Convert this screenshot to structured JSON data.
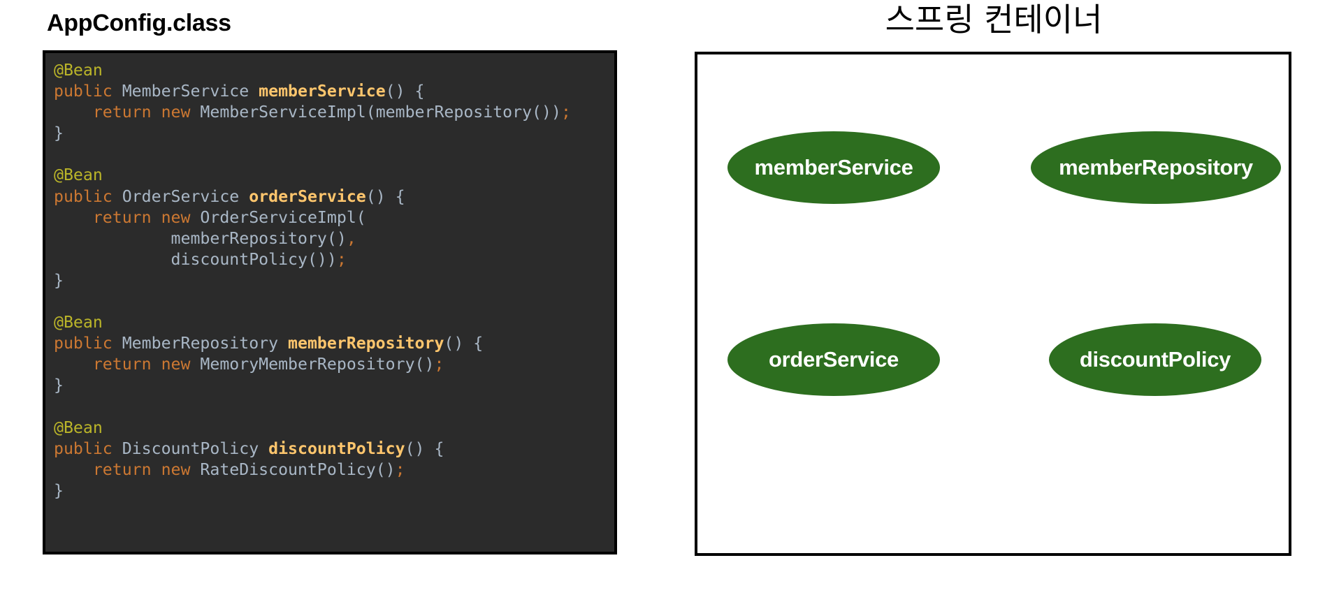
{
  "code_panel": {
    "title": "AppConfig.class",
    "colors": {
      "background": "#2b2b2b",
      "annotation": "#bbb529",
      "keyword": "#cc7832",
      "method_name": "#ffc66d",
      "plain": "#a9b7c6"
    },
    "beans": [
      {
        "annotation": "@Bean",
        "modifier": "public",
        "return_type": " MemberService ",
        "method": "memberService",
        "signature_tail": "() {",
        "body": [
          {
            "indent": "    ",
            "kw": "return new",
            "text": " MemberServiceImpl(memberRepository())",
            "semi": ";"
          }
        ],
        "close": "}"
      },
      {
        "annotation": "@Bean",
        "modifier": "public",
        "return_type": " OrderService ",
        "method": "orderService",
        "signature_tail": "() {",
        "body": [
          {
            "indent": "    ",
            "kw": "return new",
            "text": " OrderServiceImpl(",
            "semi": ""
          },
          {
            "indent": "            ",
            "kw": "",
            "text": "memberRepository()",
            "semi": ","
          },
          {
            "indent": "            ",
            "kw": "",
            "text": "discountPolicy())",
            "semi": ";"
          }
        ],
        "close": "}"
      },
      {
        "annotation": "@Bean",
        "modifier": "public",
        "return_type": " MemberRepository ",
        "method": "memberRepository",
        "signature_tail": "() {",
        "body": [
          {
            "indent": "    ",
            "kw": "return new",
            "text": " MemoryMemberRepository()",
            "semi": ";"
          }
        ],
        "close": "}"
      },
      {
        "annotation": "@Bean",
        "modifier": "public",
        "return_type": " DiscountPolicy ",
        "method": "discountPolicy",
        "signature_tail": "() {",
        "body": [
          {
            "indent": "    ",
            "kw": "return new",
            "text": " RateDiscountPolicy()",
            "semi": ";"
          }
        ],
        "close": "}"
      }
    ]
  },
  "container": {
    "title": "스프링 컨테이너",
    "bean_color": "#2d6e1f",
    "beans": [
      {
        "label": "memberService"
      },
      {
        "label": "memberRepository"
      },
      {
        "label": "orderService"
      },
      {
        "label": "discountPolicy"
      }
    ]
  }
}
